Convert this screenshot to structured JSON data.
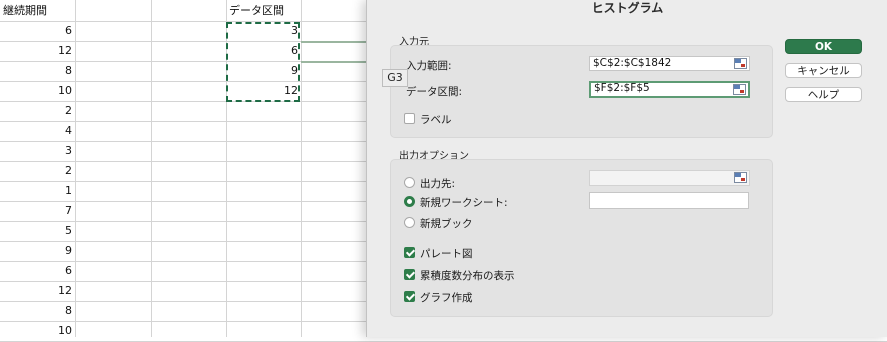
{
  "sheet": {
    "header_c": "継続期間",
    "header_f": "データ区間",
    "col_c_values": [
      "6",
      "12",
      "8",
      "10",
      "2",
      "4",
      "3",
      "2",
      "1",
      "7",
      "5",
      "9",
      "6",
      "12",
      "8",
      "10"
    ],
    "col_f_values": [
      "3",
      "6",
      "9",
      "12"
    ]
  },
  "tooltip": {
    "cell_ref": "G3"
  },
  "dialog": {
    "title": "ヒストグラム",
    "input_section": {
      "title": "入力元",
      "input_range_label": "入力範囲:",
      "input_range_value": "$C$2:$C$1842",
      "bin_range_label": "データ区間:",
      "bin_range_value": "$F$2:$F$5",
      "labels_checkbox": {
        "label": "ラベル",
        "checked": false
      }
    },
    "output_section": {
      "title": "出力オプション",
      "output_range_label": "出力先:",
      "new_sheet_label": "新規ワークシート:",
      "new_workbook_label": "新規ブック",
      "selected_option": "new_sheet",
      "pareto": {
        "label": "パレート図",
        "checked": true
      },
      "cumulative": {
        "label": "累積度数分布の表示",
        "checked": true
      },
      "chart": {
        "label": "グラフ作成",
        "checked": true
      }
    },
    "buttons": {
      "ok": "OK",
      "cancel": "キャンセル",
      "help": "ヘルプ"
    },
    "accent_color": "#2d7a4c"
  }
}
